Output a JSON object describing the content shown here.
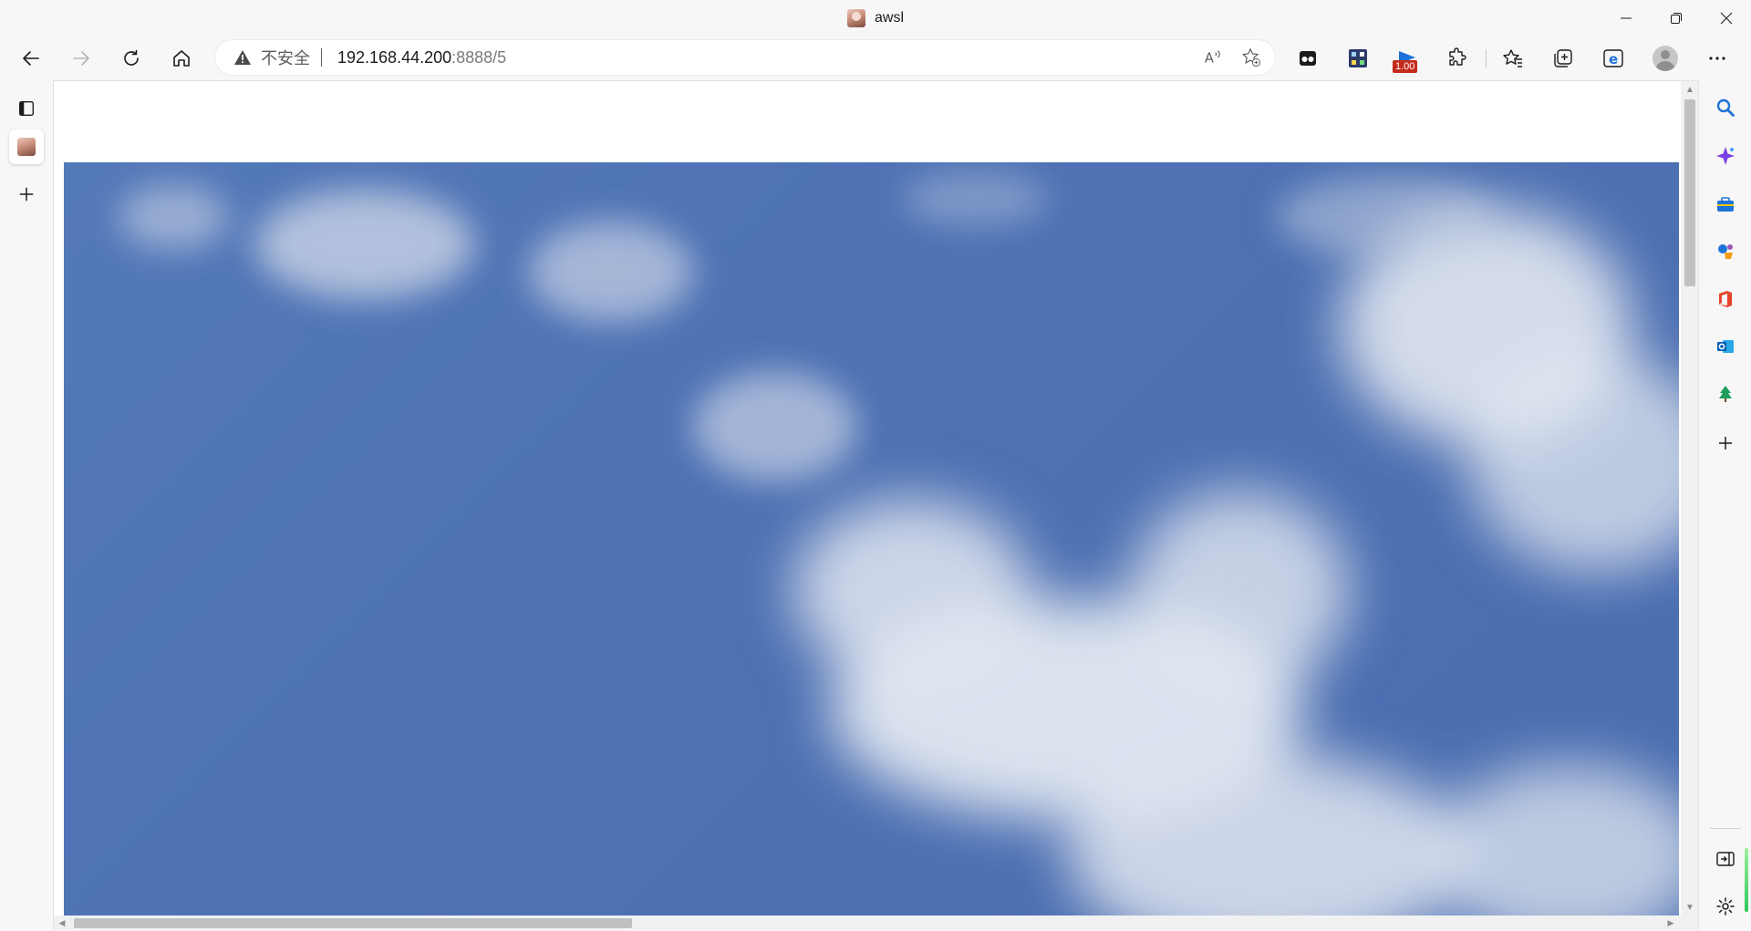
{
  "window": {
    "title": "awsl",
    "controls": [
      "minimize",
      "restore",
      "close"
    ]
  },
  "toolbar": {
    "back_icon": "arrow-left-icon",
    "forward_icon": "arrow-right-icon",
    "refresh_icon": "refresh-icon",
    "home_icon": "home-icon",
    "address": {
      "security_label": "不安全",
      "url_host": "192.168.44.200",
      "url_path": ":8888/5"
    },
    "extension_badge": "1.00",
    "extensions": [
      "tab-manager-icon",
      "qr-icon",
      "speed-flag-icon",
      "puzzle-icon"
    ],
    "actions": [
      "favorites-icon",
      "collections-icon",
      "ie-mode-icon",
      "profile-avatar",
      "more-icon"
    ]
  },
  "left_strip": {
    "items": [
      "tab-actions-icon",
      "active-tab-favicon",
      "new-tab-icon"
    ]
  },
  "content": {
    "image_description_icon": "sky-photo",
    "colors": {
      "sky": "#4e72b4",
      "cloud": "#e6ebf3"
    }
  },
  "right_sidebar": {
    "items": [
      "search-icon",
      "copilot-icon",
      "tools-icon",
      "games-icon",
      "office-icon",
      "outlook-icon",
      "tree-icon",
      "add-icon",
      "hide-sidebar-icon",
      "settings-icon"
    ]
  }
}
